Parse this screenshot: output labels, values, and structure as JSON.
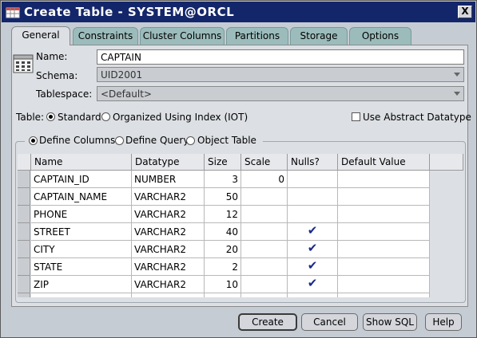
{
  "window": {
    "title": "Create Table - SYSTEM@ORCL",
    "close_label": "X",
    "icon": "table-app-icon"
  },
  "tabs": [
    {
      "label": "General",
      "active": true
    },
    {
      "label": "Constraints"
    },
    {
      "label": "Cluster Columns"
    },
    {
      "label": "Partitions"
    },
    {
      "label": "Storage"
    },
    {
      "label": "Options"
    }
  ],
  "general": {
    "name_label": "Name:",
    "name_value": "CAPTAIN",
    "schema_label": "Schema:",
    "schema_value": "UID2001",
    "tablespace_label": "Tablespace:",
    "tablespace_value": "<Default>",
    "table_label": "Table:",
    "table_type_standard": "Standard",
    "table_type_iot": "Organized Using Index (IOT)",
    "abstract_label": "Use Abstract Datatype",
    "define_columns": "Define Columns",
    "define_query": "Define Query",
    "object_table": "Object Table"
  },
  "columns_grid": {
    "headers": [
      "Name",
      "Datatype",
      "Size",
      "Scale",
      "Nulls?",
      "Default Value"
    ],
    "rows": [
      {
        "name": "CAPTAIN_ID",
        "datatype": "NUMBER",
        "size": "3",
        "scale": "0",
        "nulls": "",
        "default": ""
      },
      {
        "name": "CAPTAIN_NAME",
        "datatype": "VARCHAR2",
        "size": "50",
        "scale": "",
        "nulls": "",
        "default": ""
      },
      {
        "name": "PHONE",
        "datatype": "VARCHAR2",
        "size": "12",
        "scale": "",
        "nulls": "",
        "default": ""
      },
      {
        "name": "STREET",
        "datatype": "VARCHAR2",
        "size": "40",
        "scale": "",
        "nulls": "✔",
        "default": ""
      },
      {
        "name": "CITY",
        "datatype": "VARCHAR2",
        "size": "20",
        "scale": "",
        "nulls": "✔",
        "default": ""
      },
      {
        "name": "STATE",
        "datatype": "VARCHAR2",
        "size": "2",
        "scale": "",
        "nulls": "✔",
        "default": ""
      },
      {
        "name": "ZIP",
        "datatype": "VARCHAR2",
        "size": "10",
        "scale": "",
        "nulls": "✔",
        "default": ""
      }
    ]
  },
  "buttons": {
    "create": "Create",
    "cancel": "Cancel",
    "show_sql": "Show SQL",
    "help": "Help"
  },
  "colors": {
    "titlebar": "#14266a",
    "tab": "#9cbcbc",
    "panel": "#dcdfe3",
    "window": "#c6ccd4",
    "check": "#1a2a8a"
  }
}
